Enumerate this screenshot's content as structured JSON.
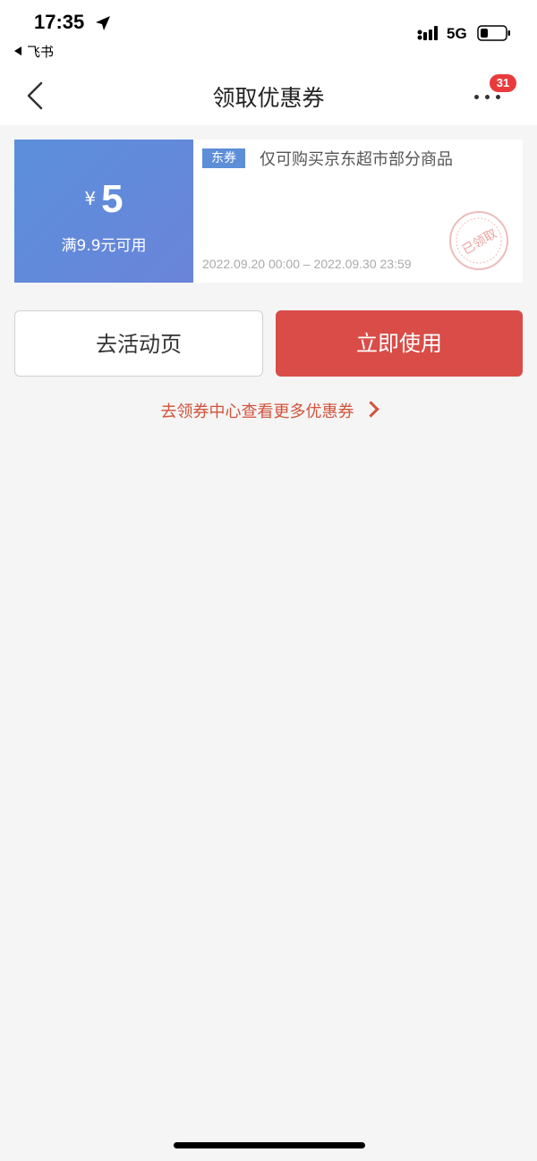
{
  "status_bar": {
    "time": "17:35",
    "back_app": "飞书",
    "network": "5G",
    "icons": [
      "location-arrow-icon",
      "signal-icon",
      "battery-icon"
    ]
  },
  "nav": {
    "title": "领取优惠券",
    "badge_count": "31",
    "icons": [
      "back-chevron-icon",
      "more-dots-icon"
    ]
  },
  "coupon": {
    "currency": "¥",
    "amount": "5",
    "condition": "满9.9元可用",
    "tag": "东券",
    "description": "仅可购买京东超市部分商品",
    "validity": "2022.09.20 00:00 – 2022.09.30 23:59",
    "stamp_text": "已领取",
    "colors": {
      "left_bg": "#6a8bd9",
      "tag_bg": "#5d8ed8",
      "stamp": "#e9a3a0"
    }
  },
  "buttons": {
    "activity": "去活动页",
    "use_now": "立即使用"
  },
  "more_link": "去领券中心查看更多优惠券",
  "colors": {
    "primary": "#d94c47",
    "link": "#d2533b",
    "background": "#f5f5f5"
  }
}
